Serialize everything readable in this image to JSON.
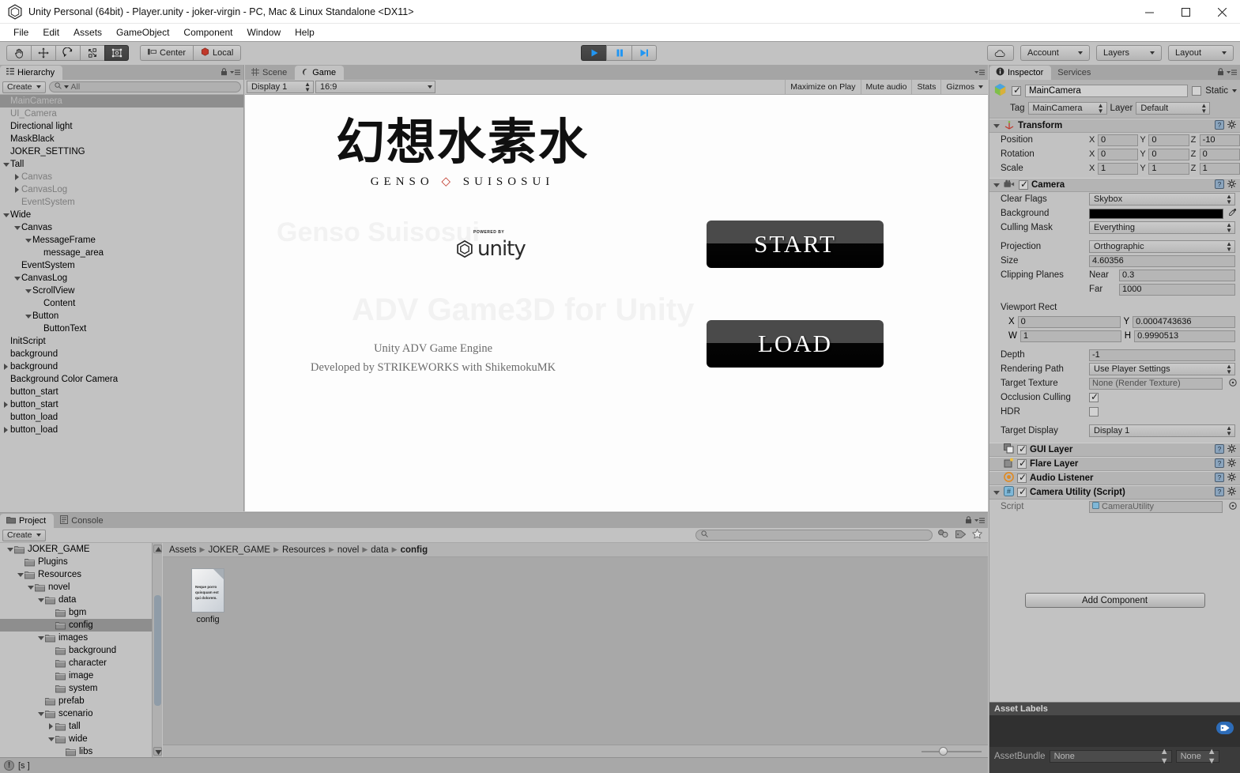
{
  "window": {
    "title": "Unity Personal (64bit) - Player.unity - joker-virgin - PC, Mac & Linux Standalone <DX11>",
    "minimize": "minimize-icon",
    "maximize": "maximize-icon",
    "close": "close-icon"
  },
  "menubar": {
    "items": [
      "File",
      "Edit",
      "Assets",
      "GameObject",
      "Component",
      "Window",
      "Help"
    ]
  },
  "toolbar": {
    "tools": [
      {
        "name": "hand-tool",
        "icon": "hand-icon",
        "active": false
      },
      {
        "name": "move-tool",
        "icon": "move-icon",
        "active": false
      },
      {
        "name": "rotate-tool",
        "icon": "rotate-icon",
        "active": false
      },
      {
        "name": "scale-tool",
        "icon": "scale-icon",
        "active": false
      },
      {
        "name": "rect-tool",
        "icon": "rect-transform-icon",
        "active": true
      }
    ],
    "pivot_mode": "Center",
    "pivot_rotation": "Local",
    "play": "play-icon",
    "pause": "pause-icon",
    "step": "step-icon",
    "cloud": "cloud-icon",
    "account": "Account",
    "layers": "Layers",
    "layout": "Layout"
  },
  "hierarchy": {
    "tab": "Hierarchy",
    "create_label": "Create",
    "search_placeholder": "All",
    "items": [
      {
        "label": "MainCamera",
        "depth": 0,
        "twisty": "none",
        "selected": true,
        "inactive": true
      },
      {
        "label": "UI_Camera",
        "depth": 0,
        "twisty": "none",
        "selected": false,
        "inactive": true
      },
      {
        "label": "Directional light",
        "depth": 0,
        "twisty": "none",
        "selected": false,
        "inactive": false
      },
      {
        "label": "MaskBlack",
        "depth": 0,
        "twisty": "none",
        "selected": false,
        "inactive": false
      },
      {
        "label": "JOKER_SETTING",
        "depth": 0,
        "twisty": "none",
        "selected": false,
        "inactive": false
      },
      {
        "label": "Tall",
        "depth": 0,
        "twisty": "down",
        "selected": false,
        "inactive": false
      },
      {
        "label": "Canvas",
        "depth": 1,
        "twisty": "right",
        "selected": false,
        "inactive": true
      },
      {
        "label": "CanvasLog",
        "depth": 1,
        "twisty": "right",
        "selected": false,
        "inactive": true
      },
      {
        "label": "EventSystem",
        "depth": 1,
        "twisty": "none",
        "selected": false,
        "inactive": true
      },
      {
        "label": "Wide",
        "depth": 0,
        "twisty": "down",
        "selected": false,
        "inactive": false
      },
      {
        "label": "Canvas",
        "depth": 1,
        "twisty": "down",
        "selected": false,
        "inactive": false
      },
      {
        "label": "MessageFrame",
        "depth": 2,
        "twisty": "down",
        "selected": false,
        "inactive": false
      },
      {
        "label": "message_area",
        "depth": 3,
        "twisty": "none",
        "selected": false,
        "inactive": false
      },
      {
        "label": "EventSystem",
        "depth": 1,
        "twisty": "none",
        "selected": false,
        "inactive": false
      },
      {
        "label": "CanvasLog",
        "depth": 1,
        "twisty": "down",
        "selected": false,
        "inactive": false
      },
      {
        "label": "ScrollView",
        "depth": 2,
        "twisty": "down",
        "selected": false,
        "inactive": false
      },
      {
        "label": "Content",
        "depth": 3,
        "twisty": "none",
        "selected": false,
        "inactive": false
      },
      {
        "label": "Button",
        "depth": 2,
        "twisty": "down",
        "selected": false,
        "inactive": false
      },
      {
        "label": "ButtonText",
        "depth": 3,
        "twisty": "none",
        "selected": false,
        "inactive": false
      },
      {
        "label": "InitScript",
        "depth": 0,
        "twisty": "none",
        "selected": false,
        "inactive": false
      },
      {
        "label": "background",
        "depth": 0,
        "twisty": "none",
        "selected": false,
        "inactive": false
      },
      {
        "label": "background",
        "depth": 0,
        "twisty": "right",
        "selected": false,
        "inactive": false
      },
      {
        "label": "Background Color Camera",
        "depth": 0,
        "twisty": "none",
        "selected": false,
        "inactive": false
      },
      {
        "label": "button_start",
        "depth": 0,
        "twisty": "none",
        "selected": false,
        "inactive": false
      },
      {
        "label": "button_start",
        "depth": 0,
        "twisty": "right",
        "selected": false,
        "inactive": false
      },
      {
        "label": "button_load",
        "depth": 0,
        "twisty": "none",
        "selected": false,
        "inactive": false
      },
      {
        "label": "button_load",
        "depth": 0,
        "twisty": "right",
        "selected": false,
        "inactive": false
      }
    ]
  },
  "gameview": {
    "tabs": [
      {
        "label": "Scene",
        "icon": "scene-icon",
        "active": false
      },
      {
        "label": "Game",
        "icon": "game-icon",
        "active": true
      }
    ],
    "display": "Display 1",
    "aspect": "16:9",
    "maximize_on_play": "Maximize on Play",
    "mute_audio": "Mute audio",
    "stats": "Stats",
    "gizmos": "Gizmos",
    "content": {
      "title_jp": "幻想水素水",
      "title_romaji_left": "GENSO",
      "title_romaji_dot": "◇",
      "title_romaji_right": "SUISOSUI",
      "powered_by": "POWERED BY",
      "unity_name": "unity",
      "credit_line1": "Unity ADV Game Engine",
      "credit_line2": "Developed by STRIKEWORKS with ShikemokuMK",
      "ghost_text_1": "ADV Game3D for Unity",
      "buttons": [
        {
          "label": "START",
          "name": "start-button"
        },
        {
          "label": "LOAD",
          "name": "load-button"
        }
      ]
    }
  },
  "inspector": {
    "tabs": [
      {
        "label": "Inspector",
        "active": true
      },
      {
        "label": "Services",
        "active": false
      }
    ],
    "object_name": "MainCamera",
    "object_enabled": true,
    "static_label": "Static",
    "static_checked": false,
    "tag_label": "Tag",
    "tag_value": "MainCamera",
    "layer_label": "Layer",
    "layer_value": "Default",
    "transform": {
      "title": "Transform",
      "rows": [
        {
          "name": "Position",
          "x": "0",
          "y": "0",
          "z": "-10"
        },
        {
          "name": "Rotation",
          "x": "0",
          "y": "0",
          "z": "0"
        },
        {
          "name": "Scale",
          "x": "1",
          "y": "1",
          "z": "1"
        }
      ]
    },
    "camera": {
      "title": "Camera",
      "enabled": true,
      "clear_flags_label": "Clear Flags",
      "clear_flags_value": "Skybox",
      "background_label": "Background",
      "background_color": "#000000",
      "culling_mask_label": "Culling Mask",
      "culling_mask_value": "Everything",
      "projection_label": "Projection",
      "projection_value": "Orthographic",
      "size_label": "Size",
      "size_value": "4.60356",
      "clipping_label": "Clipping Planes",
      "near_label": "Near",
      "near_value": "0.3",
      "far_label": "Far",
      "far_value": "1000",
      "viewport_label": "Viewport Rect",
      "viewport_x": "0",
      "viewport_y": "0.0004743636",
      "viewport_w": "1",
      "viewport_h": "0.9990513",
      "depth_label": "Depth",
      "depth_value": "-1",
      "rendering_path_label": "Rendering Path",
      "rendering_path_value": "Use Player Settings",
      "target_texture_label": "Target Texture",
      "target_texture_value": "None (Render Texture)",
      "occlusion_label": "Occlusion Culling",
      "occlusion_checked": true,
      "hdr_label": "HDR",
      "hdr_checked": false,
      "target_display_label": "Target Display",
      "target_display_value": "Display 1"
    },
    "components": [
      {
        "title": "GUI Layer",
        "enabled": true,
        "icon": "gui-layer-icon"
      },
      {
        "title": "Flare Layer",
        "enabled": true,
        "icon": "flare-layer-icon"
      },
      {
        "title": "Audio Listener",
        "enabled": true,
        "icon": "audio-listener-icon"
      }
    ],
    "script_component": {
      "title": "Camera Utility (Script)",
      "enabled": true,
      "script_label": "Script",
      "script_value": "CameraUtility"
    },
    "add_component": "Add Component",
    "asset_labels": {
      "title": "Asset Labels",
      "bundle_label": "AssetBundle",
      "bundle_value": "None",
      "variant_value": "None"
    }
  },
  "project": {
    "tabs": [
      {
        "label": "Project",
        "active": true
      },
      {
        "label": "Console",
        "active": false
      }
    ],
    "create_label": "Create",
    "tree": [
      {
        "label": "JOKER_GAME",
        "depth": 1,
        "twisty": "down",
        "selected": false
      },
      {
        "label": "Plugins",
        "depth": 2,
        "twisty": "none",
        "selected": false
      },
      {
        "label": "Resources",
        "depth": 2,
        "twisty": "down",
        "selected": false
      },
      {
        "label": "novel",
        "depth": 3,
        "twisty": "down",
        "selected": false
      },
      {
        "label": "data",
        "depth": 4,
        "twisty": "down",
        "selected": false
      },
      {
        "label": "bgm",
        "depth": 5,
        "twisty": "none",
        "selected": false
      },
      {
        "label": "config",
        "depth": 5,
        "twisty": "none",
        "selected": true
      },
      {
        "label": "images",
        "depth": 4,
        "twisty": "down",
        "selected": false
      },
      {
        "label": "background",
        "depth": 5,
        "twisty": "none",
        "selected": false
      },
      {
        "label": "character",
        "depth": 5,
        "twisty": "none",
        "selected": false
      },
      {
        "label": "image",
        "depth": 5,
        "twisty": "none",
        "selected": false
      },
      {
        "label": "system",
        "depth": 5,
        "twisty": "none",
        "selected": false
      },
      {
        "label": "prefab",
        "depth": 4,
        "twisty": "none",
        "selected": false
      },
      {
        "label": "scenario",
        "depth": 4,
        "twisty": "down",
        "selected": false
      },
      {
        "label": "tall",
        "depth": 5,
        "twisty": "right",
        "selected": false
      },
      {
        "label": "wide",
        "depth": 5,
        "twisty": "down",
        "selected": false
      },
      {
        "label": "libs",
        "depth": 6,
        "twisty": "none",
        "selected": false
      }
    ],
    "breadcrumb": [
      "Assets",
      "JOKER_GAME",
      "Resources",
      "novel",
      "data",
      "config"
    ],
    "assets": [
      {
        "name": "config",
        "thumb_text": "Neque porro quisquam est qui dolorem."
      }
    ]
  },
  "statusbar": {
    "message": "[s  ]",
    "icon": "warning-icon"
  }
}
